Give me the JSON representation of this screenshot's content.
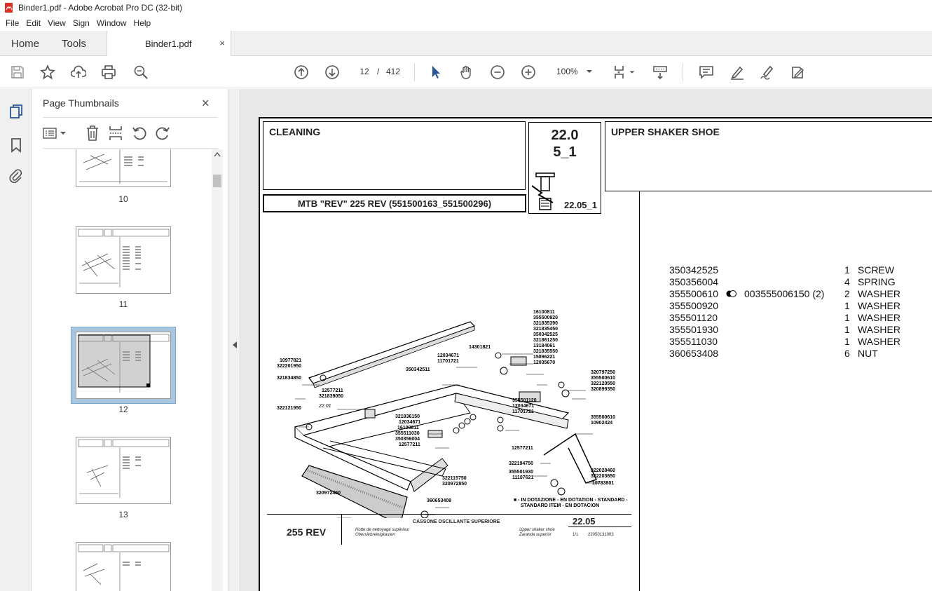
{
  "window": {
    "title": "Binder1.pdf - Adobe Acrobat Pro DC (32-bit)"
  },
  "menu": [
    "File",
    "Edit",
    "View",
    "Sign",
    "Window",
    "Help"
  ],
  "tabs": {
    "home": "Home",
    "tools": "Tools",
    "document": "Binder1.pdf",
    "close": "×"
  },
  "toolbar": {
    "page_current": "12",
    "page_sep": "/",
    "page_total": "412",
    "zoom": "100%"
  },
  "thumbnails": {
    "title": "Page Thumbnails",
    "close": "×",
    "pages": [
      {
        "num": "10"
      },
      {
        "num": "11"
      },
      {
        "num": "12",
        "selected": true
      },
      {
        "num": "13"
      }
    ]
  },
  "document": {
    "header_left": "CLEANING",
    "header_code_line1": "22.0",
    "header_code_line2": "5_1",
    "header_code_sub": "22.05_1",
    "header_right": "UPPER SHAKER SHOE",
    "model": "MTB \"REV\" 225 REV (551500163_551500296)",
    "footer": {
      "model": "255 REV",
      "title_it": "CASSONE OSCILLANTE SUPERIORE",
      "title_fr": "Hotte de nettoyage supérieur",
      "title_de": "Obersiebreinigkasten",
      "title_en": "Upper shaker shoe",
      "title_es": "Zaranda superior",
      "number": "22.05",
      "sheet": "1/1",
      "code": "22050131003"
    },
    "legend_line1": "■ - IN DOTAZIONE - EN DOTATION - STANDARD -",
    "legend_line2": "STANDARD ITEM - EN DOTACION",
    "diagram_labels": [
      "16100811",
      "355500920",
      "321835390",
      "321835450",
      "350342525",
      "321861250",
      "13184061",
      "321835550",
      "15896221",
      "12035670",
      "320797250",
      "355500610",
      "322120550",
      "320899350",
      "14301821",
      "12034671",
      "11701721",
      "350342511",
      "10977821",
      "322201950",
      "321834850",
      "12577211",
      "321839050",
      "22.01",
      "322121950",
      "355501120",
      "12034671",
      "11701721",
      "321836150",
      "12034671",
      "16100811",
      "355511030",
      "350356004",
      "12577211",
      "355500610",
      "10902424",
      "12577211",
      "322194750",
      "355501930",
      "11107621",
      "322028460",
      "322203650",
      "10733801",
      "322115750",
      "320972850",
      "320972450",
      "360653408"
    ],
    "parts": [
      {
        "code": "350342525",
        "alt": "",
        "qty": "1",
        "desc": "SCREW"
      },
      {
        "code": "350356004",
        "alt": "",
        "qty": "4",
        "desc": "SPRING"
      },
      {
        "code": "355500610",
        "alt": "003555006150  (2)",
        "qty": "2",
        "desc": "WASHER",
        "marker": true
      },
      {
        "code": "355500920",
        "alt": "",
        "qty": "1",
        "desc": "WASHER"
      },
      {
        "code": "355501120",
        "alt": "",
        "qty": "1",
        "desc": "WASHER"
      },
      {
        "code": "355501930",
        "alt": "",
        "qty": "1",
        "desc": "WASHER"
      },
      {
        "code": "355511030",
        "alt": "",
        "qty": "1",
        "desc": "WASHER"
      },
      {
        "code": "360653408",
        "alt": "",
        "qty": "6",
        "desc": "NUT"
      }
    ]
  },
  "colors": {
    "accent_blue": "#2b5797",
    "selection": "#a9c6e0",
    "pdf_red": "#d93025"
  }
}
